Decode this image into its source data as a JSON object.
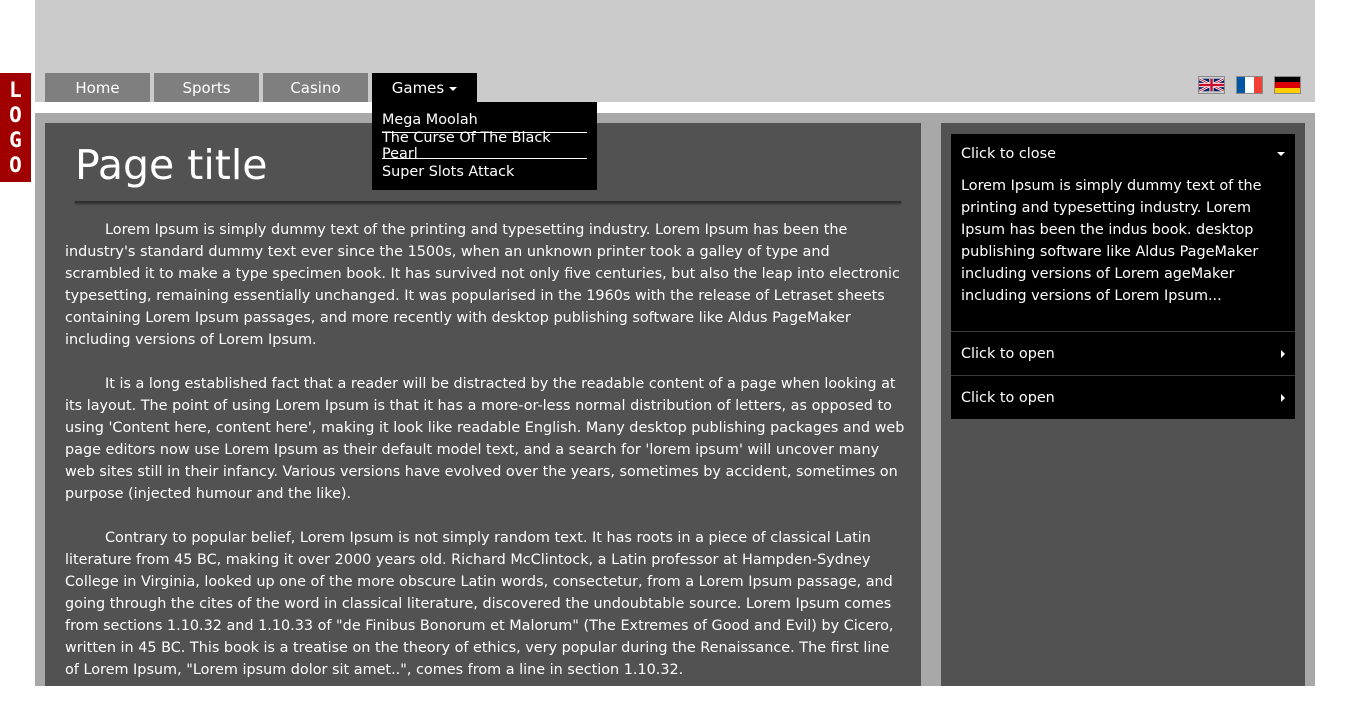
{
  "logo": {
    "letters": [
      "L",
      "O",
      "G",
      "O"
    ]
  },
  "nav": {
    "home": "Home",
    "sports": "Sports",
    "casino": "Casino",
    "games": "Games",
    "games_menu": [
      "Mega Moolah",
      "The Curse Of The Black Pearl",
      "Super Slots Attack"
    ]
  },
  "flags": {
    "icons": [
      "uk-flag-icon",
      "france-flag-icon",
      "germany-flag-icon"
    ]
  },
  "main": {
    "title": "Page title",
    "paragraphs": [
      "Lorem Ipsum is simply dummy text of the printing and typesetting industry. Lorem Ipsum has been the industry's standard dummy text ever since the 1500s, when an unknown printer took a galley of type and scrambled it to make a type specimen book. It has survived not only five centuries, but also the leap into electronic typesetting, remaining essentially unchanged. It was popularised in the 1960s with the release of Letraset sheets containing Lorem Ipsum passages, and more recently with desktop publishing software like Aldus PageMaker including versions of Lorem Ipsum.",
      "It is a long established fact that a reader will be distracted by the readable content of a page when looking at its layout. The point of using Lorem Ipsum is that it has a more-or-less normal distribution of letters, as opposed to using 'Content here, content here', making it look like readable English. Many desktop publishing packages and web page editors now use Lorem Ipsum as their default model text, and a search for 'lorem ipsum' will uncover many web sites still in their infancy. Various versions have evolved over the years, sometimes by accident, sometimes on purpose (injected humour and the like).",
      "Contrary to popular belief, Lorem Ipsum is not simply random text. It has roots in a piece of classical Latin literature from 45 BC, making it over 2000 years old. Richard McClintock, a Latin professor at Hampden-Sydney College in Virginia, looked up one of the more obscure Latin words, consectetur, from a Lorem Ipsum passage, and going through the cites of the word in classical literature, discovered the undoubtable source. Lorem Ipsum comes from sections 1.10.32 and 1.10.33 of \"de Finibus Bonorum et Malorum\" (The Extremes of Good and Evil) by Cicero, written in 45 BC. This book is a treatise on the theory of ethics, very popular during the Renaissance. The first line of Lorem Ipsum, \"Lorem ipsum dolor sit amet..\", comes from a line in section 1.10.32."
    ]
  },
  "sidebar": {
    "accordion": [
      {
        "label": "Click to close",
        "open": true,
        "body": "Lorem Ipsum is simply dummy text of the printing and typesetting industry. Lorem Ipsum has been the indus book. desktop publishing software like Aldus PageMaker including versions of Lorem ageMaker including versions of Lorem Ipsum..."
      },
      {
        "label": "Click to open",
        "open": false
      },
      {
        "label": "Click to open",
        "open": false
      }
    ]
  },
  "colors": {
    "header_bg": "#cbcbcb",
    "nav_bg": "#7f7f7f",
    "nav_active": "#000000",
    "content_bg": "#525252",
    "frame_bg": "#a8a8a8",
    "logo_bg": "#a00000"
  }
}
